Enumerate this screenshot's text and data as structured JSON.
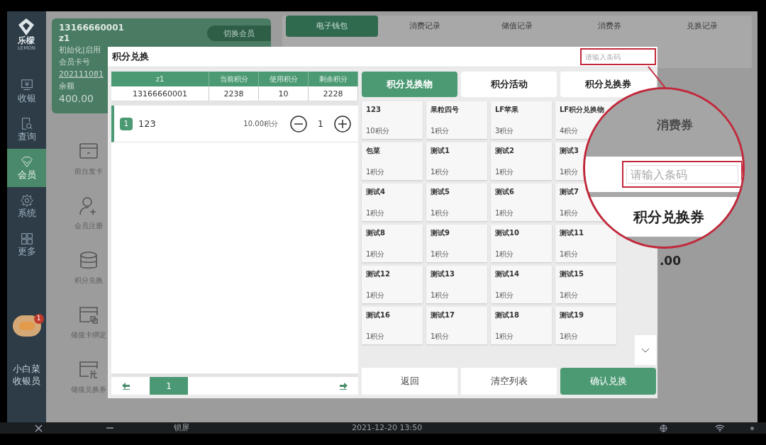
{
  "sidebar": {
    "logo": {
      "name": "乐檬",
      "sub": "LEMON"
    },
    "items": [
      {
        "label": "收银",
        "selected": false
      },
      {
        "label": "查询",
        "selected": false
      },
      {
        "label": "会员",
        "selected": true
      },
      {
        "label": "系统",
        "selected": false
      },
      {
        "label": "更多",
        "selected": false
      }
    ],
    "notification_badge": "1",
    "user": {
      "name": "小白菜",
      "role": "收银员"
    }
  },
  "member_card": {
    "phone": "13166660001",
    "name": "z1",
    "status": "初始化|启用",
    "card_label": "会员卡号",
    "card_no": "202111081",
    "balance_label": "余额",
    "balance": "400.00",
    "switch_button": "切换会员"
  },
  "record_tabs": [
    {
      "label": "电子钱包",
      "selected": true
    },
    {
      "label": "消费记录",
      "selected": false
    },
    {
      "label": "储值记录",
      "selected": false
    },
    {
      "label": "消费券",
      "selected": false
    },
    {
      "label": "兑换记录",
      "selected": false
    }
  ],
  "actions": [
    {
      "label": "前台发卡"
    },
    {
      "label": "会员注册"
    },
    {
      "label": "积分兑换"
    },
    {
      "label": "储值卡绑定"
    },
    {
      "label": "储值兑换券"
    }
  ],
  "background_text": ".00",
  "dialog": {
    "title": "积分兑换",
    "barcode_placeholder": "请输入条码",
    "summary": {
      "columns": [
        "z1",
        "当前积分",
        "使用积分",
        "剩余积分"
      ],
      "row": [
        "13166660001",
        "2238",
        "10",
        "2228"
      ]
    },
    "cart": [
      {
        "index": "1",
        "name": "123",
        "points": "10.00积分",
        "quantity": "1"
      }
    ],
    "pager": {
      "page": "1"
    },
    "category_tabs": [
      {
        "label": "积分兑换物",
        "selected": true
      },
      {
        "label": "积分活动",
        "selected": false
      },
      {
        "label": "积分兑换券",
        "selected": false
      }
    ],
    "products": [
      {
        "name": "123",
        "points": "10积分"
      },
      {
        "name": "果粒四号",
        "points": "1积分"
      },
      {
        "name": "LF苹果",
        "points": "3积分"
      },
      {
        "name": "LF积分兑换物",
        "points": "4积分"
      },
      {
        "name": "包菜",
        "points": "1积分"
      },
      {
        "name": "测试1",
        "points": "1积分"
      },
      {
        "name": "测试2",
        "points": "1积分"
      },
      {
        "name": "测试3",
        "points": "1积分"
      },
      {
        "name": "测试4",
        "points": "1积分"
      },
      {
        "name": "测试5",
        "points": "1积分"
      },
      {
        "name": "测试6",
        "points": "1积分"
      },
      {
        "name": "测试7",
        "points": "1积分"
      },
      {
        "name": "测试8",
        "points": "1积分"
      },
      {
        "name": "测试9",
        "points": "1积分"
      },
      {
        "name": "测试10",
        "points": "1积分"
      },
      {
        "name": "测试11",
        "points": "1积分"
      },
      {
        "name": "测试12",
        "points": "1积分"
      },
      {
        "name": "测试13",
        "points": "1积分"
      },
      {
        "name": "测试14",
        "points": "1积分"
      },
      {
        "name": "测试15",
        "points": "1积分"
      },
      {
        "name": "测试16",
        "points": "1积分"
      },
      {
        "name": "测试17",
        "points": "1积分"
      },
      {
        "name": "测试18",
        "points": "1积分"
      },
      {
        "name": "测试19",
        "points": "1积分"
      }
    ],
    "buttons": [
      {
        "label": "返回",
        "kind": "plain"
      },
      {
        "label": "清空列表",
        "kind": "plain"
      },
      {
        "label": "确认兑换",
        "kind": "primary"
      }
    ]
  },
  "magnifier": {
    "tab_label": "消费券",
    "barcode_placeholder": "请输入条码",
    "button_label": "积分兑换券"
  },
  "taskbar": {
    "lock": "锁屏",
    "datetime": "2021-12-20 13:50"
  }
}
